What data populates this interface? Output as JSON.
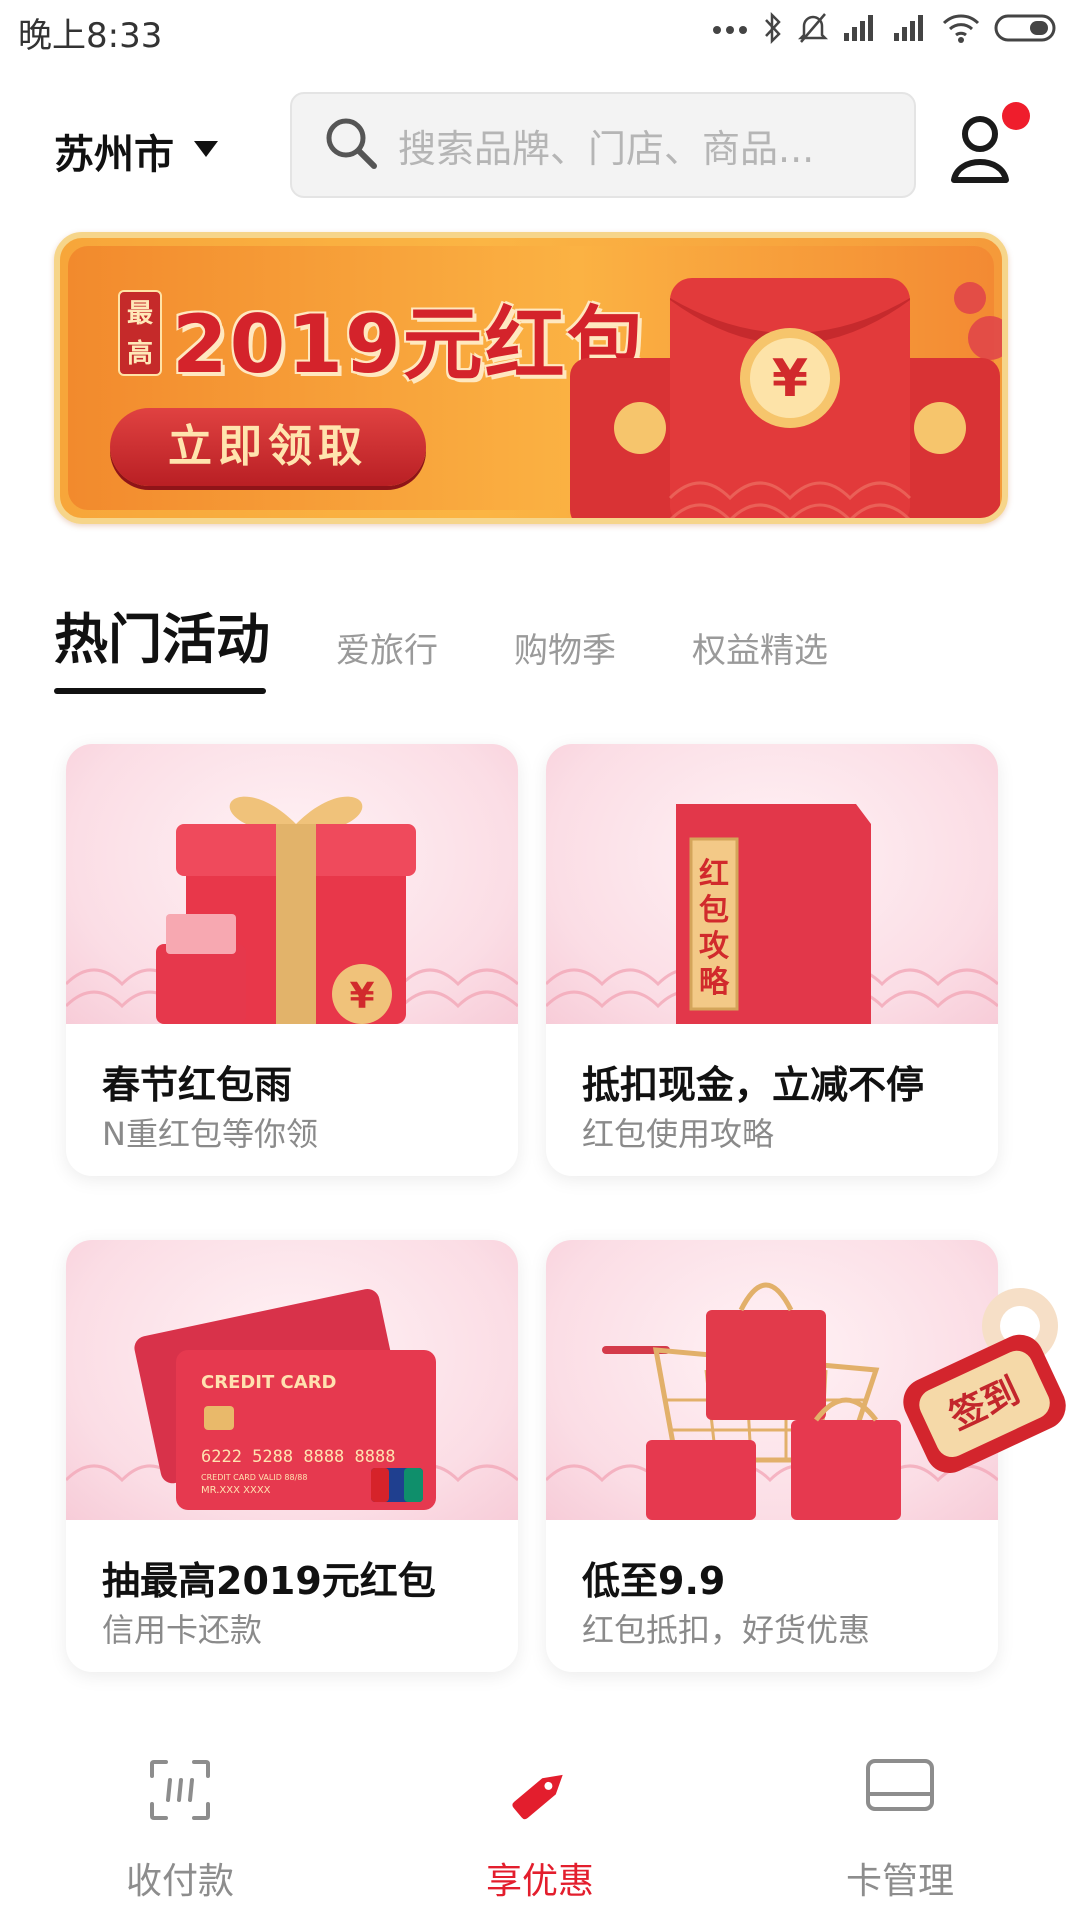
{
  "status_bar": {
    "time": "晚上8:33"
  },
  "header": {
    "city": "苏州市",
    "search_placeholder": "搜索品牌、门店、商品..."
  },
  "banner": {
    "tag": "最高",
    "title": "2019元红包",
    "button": "立即领取"
  },
  "tabs": [
    {
      "label": "热门活动",
      "active": true
    },
    {
      "label": "爱旅行",
      "active": false
    },
    {
      "label": "购物季",
      "active": false
    },
    {
      "label": "权益精选",
      "active": false
    }
  ],
  "cards": [
    {
      "title": "春节红包雨",
      "subtitle": "N重红包等你领"
    },
    {
      "title": "抵扣现金，立减不停",
      "subtitle": "红包使用攻略",
      "envelope_text": "红包攻略"
    },
    {
      "title": "抽最高2019元红包",
      "subtitle": "信用卡还款",
      "card_brand": "CREDIT CARD",
      "card_number": "6222 5288 8888 8888",
      "card_meta": "CREDIT CARD   VALID  88/88",
      "card_holder": "MR.XXX XXXX",
      "unionpay": "UnionPay 银联"
    },
    {
      "title": "低至9.9",
      "subtitle": "红包抵扣，好货优惠"
    }
  ],
  "signin_tag": "签到",
  "bottom_nav": [
    {
      "label": "收付款",
      "active": false,
      "icon": "scan-icon"
    },
    {
      "label": "享优惠",
      "active": true,
      "icon": "tag-icon"
    },
    {
      "label": "卡管理",
      "active": false,
      "icon": "card-icon"
    }
  ],
  "colors": {
    "accent": "#e31e2d",
    "banner_orange": "#f7a63a",
    "card_pink": "#fbdde5"
  }
}
